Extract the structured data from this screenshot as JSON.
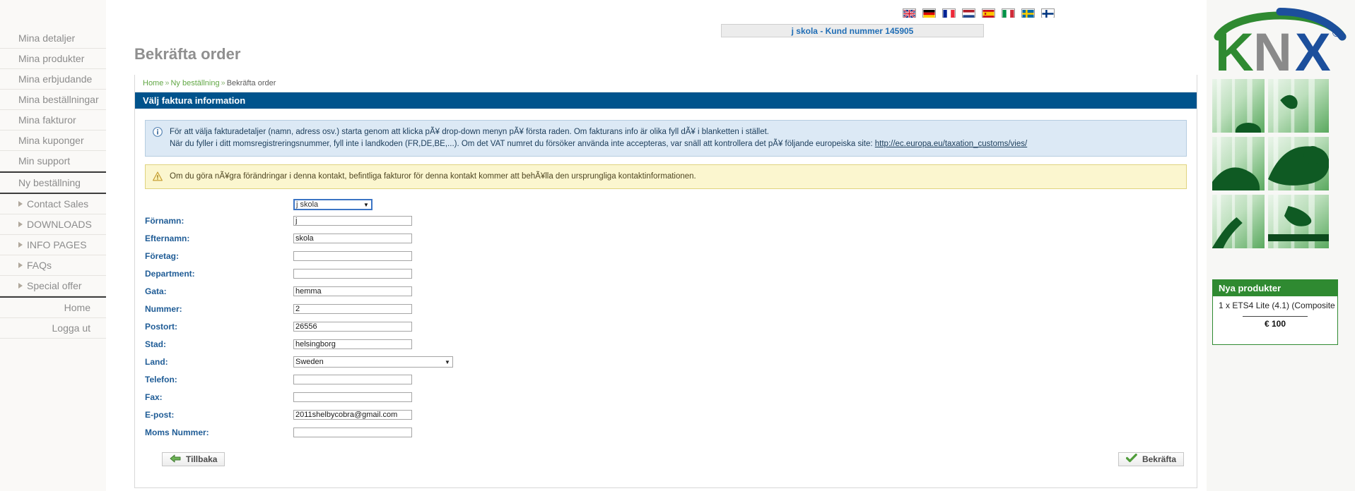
{
  "sidebar": {
    "items": [
      {
        "label": "Mina detaljer",
        "arrow": false
      },
      {
        "label": "Mina produkter",
        "arrow": false
      },
      {
        "label": "Mina erbjudande",
        "arrow": false
      },
      {
        "label": "Mina beställningar",
        "arrow": false
      },
      {
        "label": "Mina fakturor",
        "arrow": false
      },
      {
        "label": "Mina kuponger",
        "arrow": false
      },
      {
        "label": "Min support",
        "arrow": false
      },
      {
        "label": "Ny beställning",
        "arrow": false
      },
      {
        "label": "Contact Sales",
        "arrow": true
      },
      {
        "label": "DOWNLOADS",
        "arrow": true
      },
      {
        "label": "INFO PAGES",
        "arrow": true
      },
      {
        "label": "FAQs",
        "arrow": true
      },
      {
        "label": "Special offer",
        "arrow": true
      },
      {
        "label": "Home",
        "arrow": false
      },
      {
        "label": "Logga ut",
        "arrow": false
      }
    ]
  },
  "header": {
    "flags": [
      "flag-uk",
      "flag-germany",
      "flag-france",
      "flag-netherlands",
      "flag-spain",
      "flag-italy",
      "flag-sweden",
      "flag-finland"
    ],
    "customer": "j skola - Kund nummer 145905"
  },
  "page": {
    "title": "Bekräfta order",
    "breadcrumb": {
      "home": "Home",
      "section": "Ny beställning",
      "current": "Bekräfta order",
      "separator": "»"
    },
    "panel_title": "Välj faktura information"
  },
  "alerts": {
    "info": {
      "icon": "info-icon",
      "line1": "För att välja fakturadetaljer (namn, adress osv.) starta genom att klicka pÃ¥ drop-down menyn pÃ¥ första raden. Om fakturans info är olika fyll dÃ¥ i blanketten i stället.",
      "line2_pre": "När du fyller i ditt momsregistreringsnummer, fyll inte i landkoden (FR,DE,BE,...). Om det VAT numret du försöker använda inte accepteras, var snäll att kontrollera det pÃ¥ följande europeiska site: ",
      "link": "http://ec.europa.eu/taxation_customs/vies/"
    },
    "warning": {
      "icon": "warning-icon",
      "text": "Om du göra nÃ¥gra förändringar i denna kontakt, befintliga fakturor för denna kontakt kommer att behÃ¥lla den ursprungliga kontaktinformationen."
    }
  },
  "form": {
    "contact_select": {
      "value": "j skola",
      "caret": "▼"
    },
    "fields": [
      {
        "label": "Förnamn:",
        "value": "j",
        "type": "text"
      },
      {
        "label": "Efternamn:",
        "value": "skola",
        "type": "text"
      },
      {
        "label": "Företag:",
        "value": "",
        "type": "text"
      },
      {
        "label": "Department:",
        "value": "",
        "type": "text"
      },
      {
        "label": "Gata:",
        "value": "hemma",
        "type": "text"
      },
      {
        "label": "Nummer:",
        "value": "2",
        "type": "text"
      },
      {
        "label": "Postort:",
        "value": "26556",
        "type": "text"
      },
      {
        "label": "Stad:",
        "value": "helsingborg",
        "type": "text"
      },
      {
        "label": "Land:",
        "value": "Sweden",
        "type": "select"
      },
      {
        "label": "Telefon:",
        "value": "",
        "type": "text"
      },
      {
        "label": "Fax:",
        "value": "",
        "type": "text"
      },
      {
        "label": "E-post:",
        "value": "2011shelbycobra@gmail.com",
        "type": "text"
      },
      {
        "label": "Moms Nummer:",
        "value": "",
        "type": "text"
      }
    ],
    "select_caret": "▼"
  },
  "buttons": {
    "back": {
      "label": "Tillbaka",
      "icon": "arrow-left-icon"
    },
    "confirm": {
      "label": "Bekräfta",
      "icon": "check-icon"
    }
  },
  "right": {
    "logo": {
      "text": "KNX",
      "trademark": "®"
    },
    "new_products": {
      "title": "Nya produkter",
      "item": "1 x ETS4 Lite (4.1) (Composite",
      "price": "€ 100"
    },
    "thumbnails": [
      "athlete-thumb-1",
      "athlete-thumb-2",
      "athlete-thumb-3",
      "athlete-thumb-4",
      "athlete-thumb-5",
      "athlete-thumb-6"
    ]
  },
  "colors": {
    "panel_blue": "#00538c",
    "label_blue": "#1f5c96",
    "link_green": "#61a744",
    "brand_green": "#2f8a31",
    "brand_blue": "#1c4f9c"
  }
}
